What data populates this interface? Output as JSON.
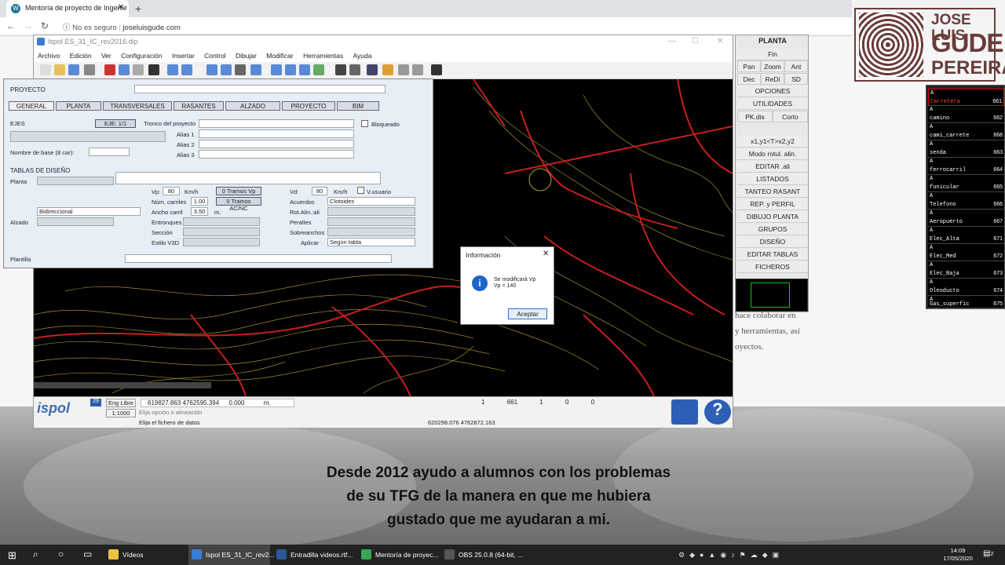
{
  "browser": {
    "tab_title": "Mentoría de proyecto de Ingenie",
    "url_security": "No es seguro",
    "url": "joseluisgude.com"
  },
  "site": {
    "logo": {
      "line1": "JOSE LUIS",
      "line2": "GUDE",
      "line3": "PEREIRA"
    },
    "side_text": [
      "hace colaborar en",
      "y herramientas, así",
      "oyectos."
    ],
    "caption_lines": [
      "Desde 2012 ayudo a alumnos con los problemas",
      "de su TFG de la manera en que me hubiera",
      "gustado que me ayudaran a mi."
    ]
  },
  "app": {
    "title": "Ispol  ES_31_IC_rev2016.dip",
    "menu": [
      "Archivo",
      "Edición",
      "Ver",
      "Configuración",
      "Insertar",
      "Control",
      "Dibujar",
      "Modificar",
      "Herramientas",
      "Ayuda"
    ],
    "panel": {
      "proyecto_label": "PROYECTO",
      "tabs": [
        "GENERAL",
        "PLANTA",
        "TRANSVERSALES",
        "RASANTES",
        "ALZADO",
        "PROYECTO",
        "BIM"
      ],
      "ejes_label": "EJES",
      "eje_button": "EJE: 1/1",
      "eje_name": "Tronco del proyecto",
      "bloqueado": "Bloqueado",
      "alias": [
        "Alias 1",
        "Alias 2",
        "Alias 3"
      ],
      "nombre_base": "Nombre de base (8 car):",
      "tablas": "TABLAS DE DISEÑO",
      "planta": "Planta",
      "alzado": "Alzado",
      "plantilla": "Plantilla",
      "vp_label": "Vp:",
      "vp_value": "80",
      "vp_unit": "Km/h",
      "vp_button": "0 Tramos Vp",
      "num_carriles_label": "Núm. carriles",
      "num_carriles": "1.00",
      "tramos_acnc": "0 Tramos AC/NC",
      "bidireccional": "Bidireccional",
      "ancho_label": "Ancho carril",
      "ancho_value": "3.50",
      "ancho_unit": "m.",
      "entronques": "Entronques",
      "seccion": "Sección",
      "estilo": "Estilo V3D",
      "vd_label": "Vd:",
      "vd_value": "80",
      "vd_unit": "Km/h",
      "vusuario": "V.usuario",
      "acuerdos_label": "Acuerdos",
      "acuerdos_value": "Clotoides",
      "rot_label": "Rot.Alin.:ali",
      "peraltes": "Peraltes",
      "sobreanchos": "Sobreanchos",
      "aplicar_label": "Aplicar",
      "aplicar_value": "Según tabla"
    },
    "dialog": {
      "title": "Información",
      "line1": "Se modificará Vp",
      "line2": "Vp = 140",
      "ok": "Aceptar"
    },
    "status": {
      "logo": "ispol",
      "eng_libre": "Eng Libre",
      "coords": "619827.863  4762595.394",
      "z": "0.000",
      "unit": "m.",
      "scale": "1:1000",
      "msg1": "Elija opción o alineación",
      "msg2": "Elija el fichero de datos",
      "coords2": "620298.076  4762872.163",
      "v1": "1",
      "v2": "661",
      "v3": "1",
      "v4": "0",
      "v5": "0",
      "badge": "29"
    }
  },
  "right_panel": {
    "title": "PLANTA",
    "fin": "Fin",
    "row1": [
      "Pan",
      "Zoom",
      "Ant"
    ],
    "row2": [
      "Dec",
      "ReDi",
      "SD"
    ],
    "items_a": [
      "OPCIONES",
      "UTILIDADES"
    ],
    "row3": [
      "PK.dis",
      "Corto"
    ],
    "items_b": [
      "x1,y1<T>x2,y2",
      "Modo rotul. alin.",
      "EDITAR .ali",
      "LISTADOS",
      "TANTEO RASANT",
      "REP. y PERFIL",
      "DIBUJO PLANTA",
      "GRUPOS",
      "DISEÑO",
      "EDITAR TABLAS",
      "FICHEROS"
    ]
  },
  "layers": [
    {
      "name": "Carretera",
      "num": "661"
    },
    {
      "name": "camino",
      "num": "662"
    },
    {
      "name": "cami_carrete",
      "num": "668"
    },
    {
      "name": "senda",
      "num": "663"
    },
    {
      "name": "ferrocarril",
      "num": "664"
    },
    {
      "name": "funicular",
      "num": "665"
    },
    {
      "name": "Telefono",
      "num": "666"
    },
    {
      "name": "Aeropuerto",
      "num": "667"
    },
    {
      "name": "Elec_Alta",
      "num": "671"
    },
    {
      "name": "Elec_Med",
      "num": "672"
    },
    {
      "name": "Elec_Baja",
      "num": "673"
    },
    {
      "name": "Oleoducto",
      "num": "674"
    },
    {
      "name": "Gas_superfic",
      "num": "675"
    }
  ],
  "taskbar": {
    "items": [
      {
        "label": "Vídeos",
        "color": "#f0c040"
      },
      {
        "label": "Ispol  ES_31_IC_rev2...",
        "color": "#3a7bd5"
      },
      {
        "label": "Entradilla videos.rtf...",
        "color": "#2b5797"
      },
      {
        "label": "Mentoría de proyec...",
        "color": "#34a853"
      },
      {
        "label": "OBS 25.0.8 (64-bit, ...",
        "color": "#555555"
      }
    ],
    "time": "14:09",
    "date": "17/05/2020",
    "notif": "2"
  }
}
